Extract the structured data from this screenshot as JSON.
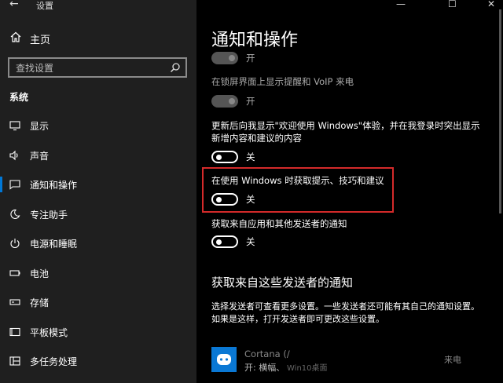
{
  "window": {
    "title": "设置",
    "controls": {
      "minimize": "—",
      "maximize": "☐",
      "close": "✕"
    }
  },
  "sidebar": {
    "back_glyph": "←",
    "home_label": "主页",
    "search_placeholder": "查找设置",
    "section": "系统",
    "items": [
      {
        "label": "显示",
        "icon": "monitor-icon",
        "active": false
      },
      {
        "label": "声音",
        "icon": "speaker-icon",
        "active": false
      },
      {
        "label": "通知和操作",
        "icon": "notification-icon",
        "active": true
      },
      {
        "label": "专注助手",
        "icon": "moon-icon",
        "active": false
      },
      {
        "label": "电源和睡眠",
        "icon": "power-icon",
        "active": false
      },
      {
        "label": "电池",
        "icon": "battery-icon",
        "active": false
      },
      {
        "label": "存储",
        "icon": "storage-icon",
        "active": false
      },
      {
        "label": "平板模式",
        "icon": "tablet-icon",
        "active": false
      },
      {
        "label": "多任务处理",
        "icon": "multitask-icon",
        "active": false
      }
    ]
  },
  "main": {
    "title": "通知和操作",
    "settings": [
      {
        "label": "",
        "state": "开",
        "enabled": false
      },
      {
        "label": "在锁屏界面上显示提醒和 VoIP 来电",
        "state": "开",
        "enabled": false
      },
      {
        "label": "更新后向我显示\"欢迎使用 Windows\"体验，并在我登录时突出显示新增内容和建议的内容",
        "state": "关",
        "enabled": true
      },
      {
        "label": "在使用 Windows 时获取提示、技巧和建议",
        "state": "关",
        "enabled": true,
        "highlighted": true
      },
      {
        "label": "获取来自应用和其他发送者的通知",
        "state": "关",
        "enabled": true
      }
    ],
    "senders_heading": "获取来自这些发送者的通知",
    "senders_desc": "选择发送者可查看更多设置。一些发送者还可能有其自己的通知设置。如果是这样，打开发送者即可更改这些设置。",
    "sender": {
      "name": "Cortana (/",
      "status": "开: 横幅、",
      "extra": "Win10桌面",
      "right_text": "来电"
    }
  },
  "colors": {
    "accent": "#0078d7",
    "highlight": "#d42a2a",
    "sidebar_bg": "#1f1f1f",
    "main_bg": "#000000"
  }
}
